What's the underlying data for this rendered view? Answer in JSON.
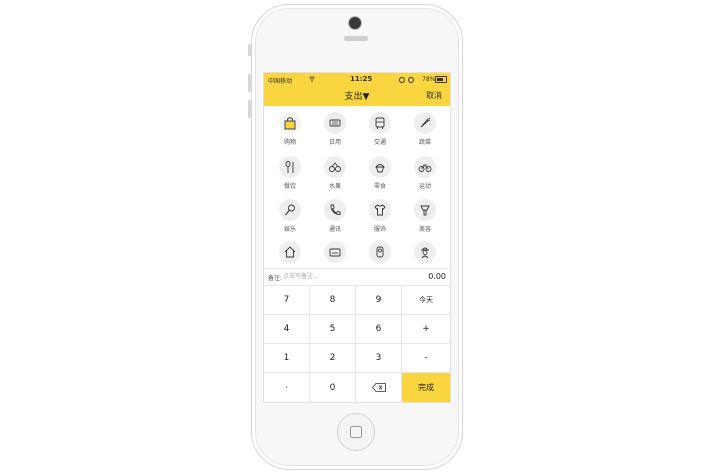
{
  "status": {
    "carrier": "中国移动",
    "time": "11:25",
    "battery": "78%"
  },
  "header": {
    "title": "支出▼",
    "cancel": "取消"
  },
  "categories": [
    {
      "label": "购物",
      "icon": "shopping-bag-icon"
    },
    {
      "label": "日用",
      "icon": "daily-goods-icon"
    },
    {
      "label": "交通",
      "icon": "bus-icon"
    },
    {
      "label": "蔬菜",
      "icon": "vegetable-icon"
    },
    {
      "label": "餐饮",
      "icon": "dining-icon"
    },
    {
      "label": "水果",
      "icon": "fruit-icon"
    },
    {
      "label": "零食",
      "icon": "snack-icon"
    },
    {
      "label": "运动",
      "icon": "bicycle-icon"
    },
    {
      "label": "娱乐",
      "icon": "microphone-icon"
    },
    {
      "label": "通讯",
      "icon": "phone-icon"
    },
    {
      "label": "服饰",
      "icon": "shirt-icon"
    },
    {
      "label": "美容",
      "icon": "beauty-icon"
    },
    {
      "label": "",
      "icon": "house-icon"
    },
    {
      "label": "",
      "icon": "sofa-icon"
    },
    {
      "label": "",
      "icon": "baby-icon"
    },
    {
      "label": "",
      "icon": "elder-icon"
    }
  ],
  "note": {
    "label": "备注:",
    "placeholder": "点击写备注...",
    "amount": "0.00"
  },
  "keypad": {
    "keys": [
      "7",
      "8",
      "9",
      "今天",
      "4",
      "5",
      "6",
      "+",
      "1",
      "2",
      "3",
      "-",
      "·",
      "0",
      "",
      "完成"
    ],
    "backspace_icon": "backspace-icon"
  },
  "colors": {
    "accent": "#f9d63f"
  }
}
